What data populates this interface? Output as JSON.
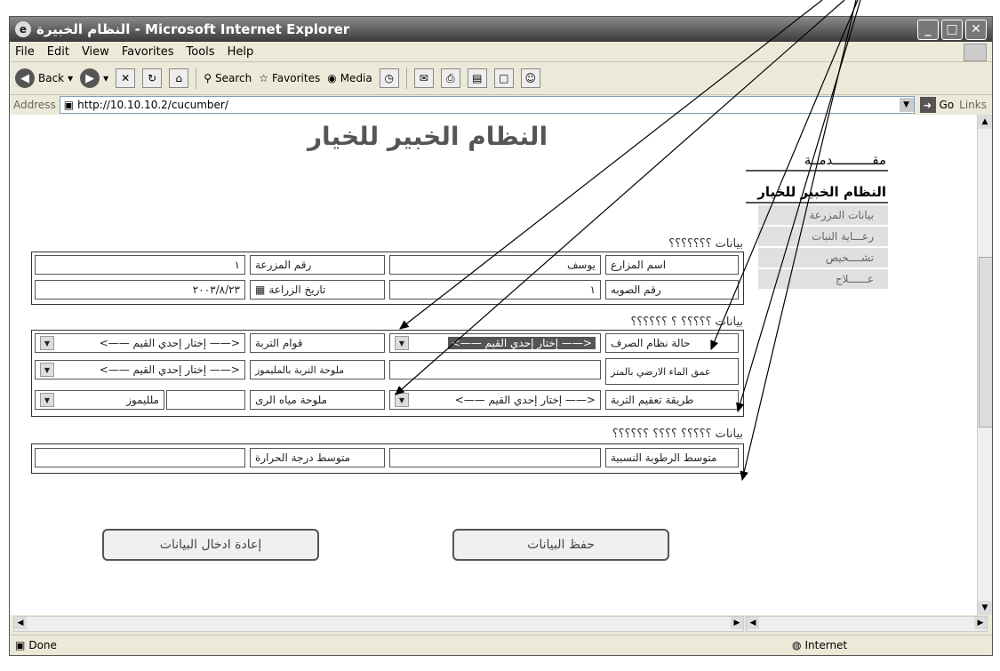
{
  "window": {
    "title": "النظام الخبيرة - Microsoft Internet Explorer"
  },
  "menu": [
    "File",
    "Edit",
    "View",
    "Favorites",
    "Tools",
    "Help"
  ],
  "toolbar": {
    "back": "Back",
    "search": "Search",
    "favorites": "Favorites",
    "media": "Media"
  },
  "address": {
    "label": "Address",
    "url": "http://10.10.10.2/cucumber/",
    "go": "Go",
    "links": "Links"
  },
  "page": {
    "title": "النظام الخبير للخيار",
    "sec1": "بيانات ؟؟؟؟؟؟؟",
    "sec2": "بيانات ؟؟؟؟؟ ؟ ؟؟؟؟؟؟",
    "sec3": "بيانات ؟؟؟؟؟ ؟؟؟؟ ؟؟؟؟؟؟",
    "row1": {
      "farmer_label": "اسم المزارع",
      "farmer_value": "يوسف",
      "farm_label": "رقم المزرعة",
      "farm_value": "١"
    },
    "row2": {
      "greenhouse_label": "رقم الصوبه",
      "greenhouse_value": "١",
      "date_label": "تاريخ الزراعة",
      "date_value": "٢٠٠٣/٨/٢٣"
    },
    "row3": {
      "drainage_label": "حالة نظام الصرف",
      "drainage_value": "<—— إختار إحدي القيم ——>",
      "texture_label": "قوام التربة",
      "texture_value": "<—— إختار إحدي القيم ——>"
    },
    "row4": {
      "water_depth_label": "عمق الماء الارضي بالمتر",
      "salinity_label": "ملوحة التربة بالمليموز",
      "salinity_value": "<—— إختار إحدي القيم ——>"
    },
    "row5": {
      "sterilize_label": "طريقة تعقيم التربة",
      "sterilize_value": "<—— إختار إحدي القيم ——>",
      "irrigation_label": "ملوحة مياه الرى",
      "unit_value": "ملليموز"
    },
    "row6": {
      "humidity_label": "متوسط الرطوبة النسبية",
      "temp_label": "متوسط درجة الحرارة"
    },
    "save_button": "حفظ البيانات",
    "reset_button": "إعادة ادخال البيانات"
  },
  "sidebar": {
    "intro": "مقــــــــــدمــة",
    "system": "النظام الخبير للخيار",
    "items": [
      "بيانات المزرعة",
      "رعـــاية النبات",
      "تشــــخيص",
      "عــــــلاج"
    ]
  },
  "status": {
    "done": "Done",
    "zone": "Internet"
  }
}
